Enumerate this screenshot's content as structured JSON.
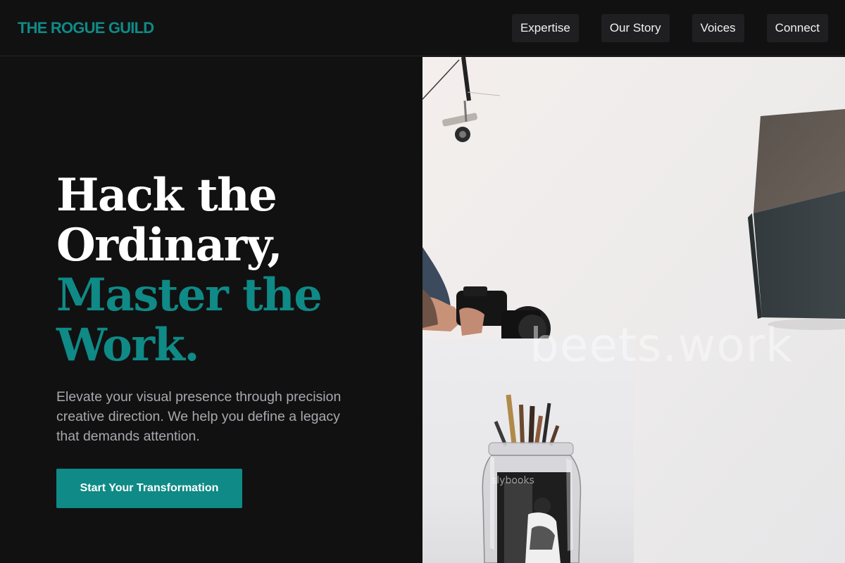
{
  "header": {
    "brand": "THE ROGUE GUILD",
    "nav": [
      {
        "label": "Expertise"
      },
      {
        "label": "Our Story"
      },
      {
        "label": "Voices"
      },
      {
        "label": "Connect"
      }
    ]
  },
  "hero": {
    "headline_line1": "Hack the",
    "headline_line2": "Ordinary,",
    "headline_line3": "Master the",
    "headline_line4": "Work.",
    "subtext": "Elevate your visual presence through precision creative direction. We help you define a legacy that demands attention.",
    "cta_label": "Start Your Transformation"
  },
  "images": {
    "main_watermark": "beets.work",
    "inset_watermark": "slybooks"
  },
  "colors": {
    "accent": "#0f8a86",
    "background": "#111112",
    "nav_button": "#1f1f21",
    "subtext": "#a8a9ad"
  }
}
